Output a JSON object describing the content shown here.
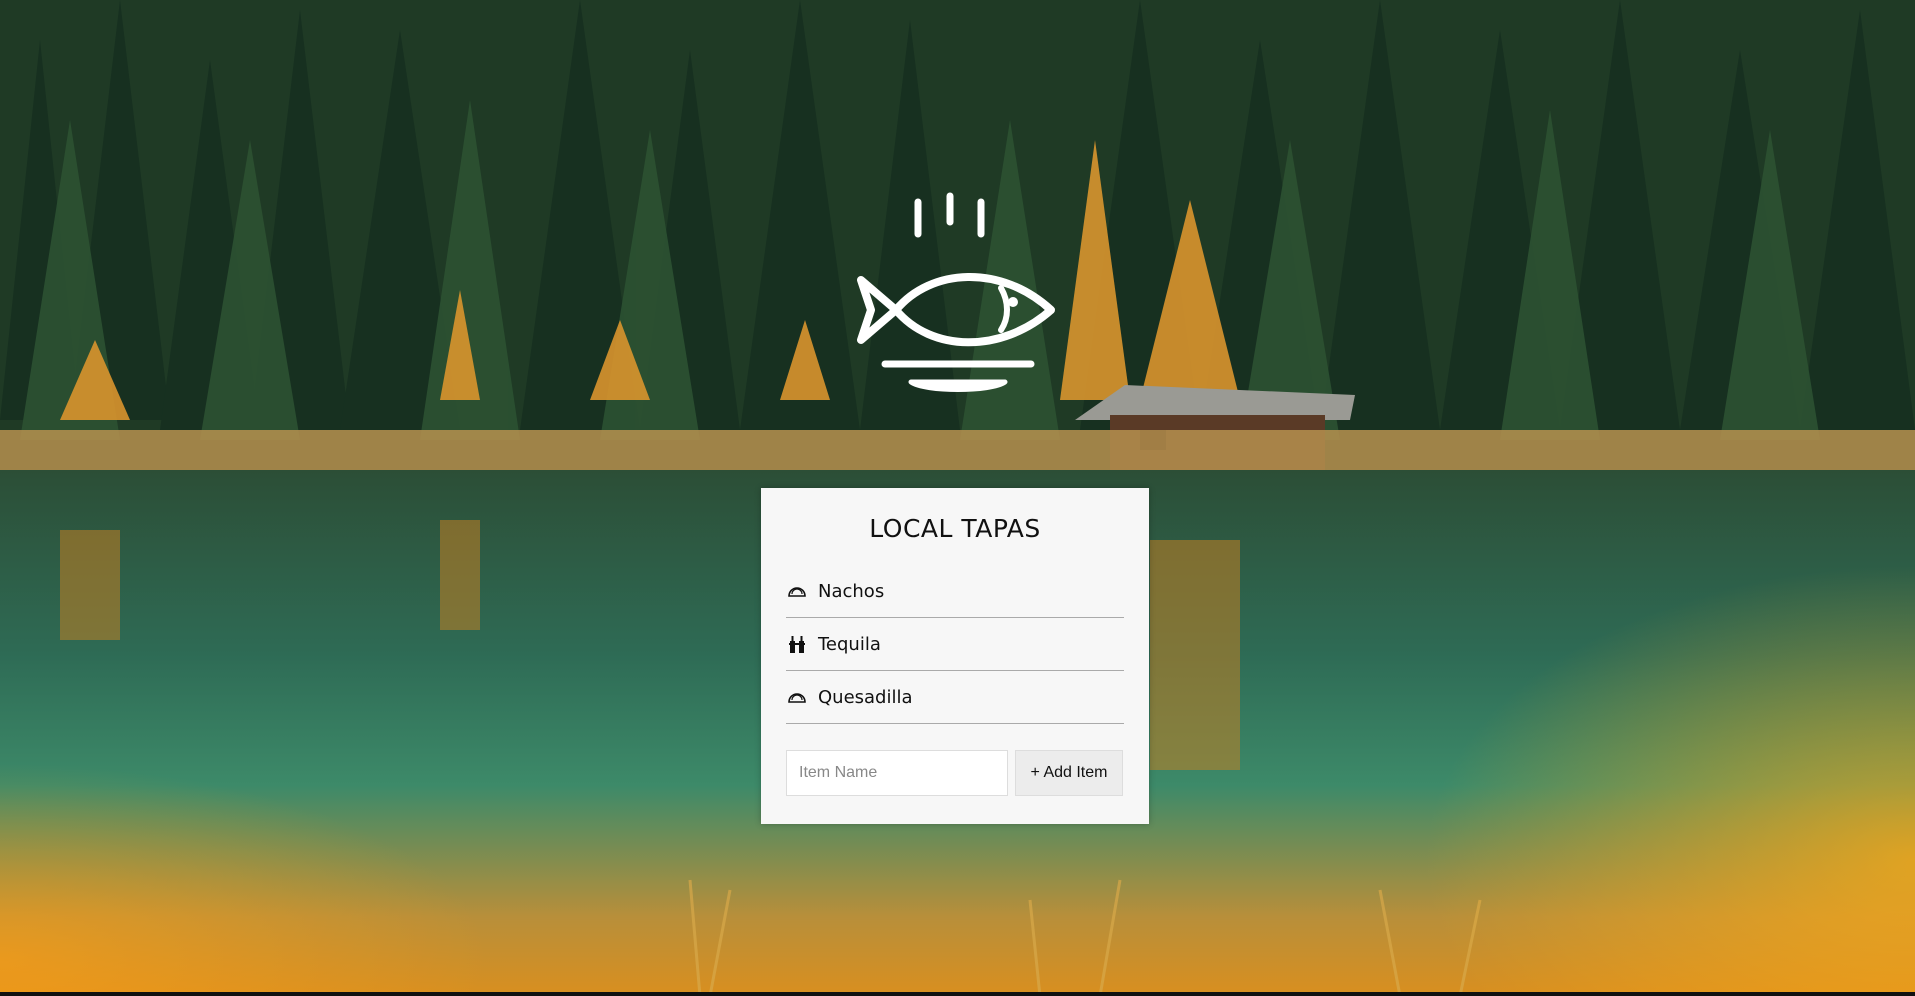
{
  "app": {
    "title": "LOCAL TAPAS",
    "logo_icon": "fish-dish-icon"
  },
  "menu": {
    "items": [
      {
        "label": "Nachos",
        "icon": "taco-icon"
      },
      {
        "label": "Tequila",
        "icon": "drinks-icon"
      },
      {
        "label": "Quesadilla",
        "icon": "taco-icon"
      }
    ]
  },
  "form": {
    "placeholder": "Item Name",
    "value": "",
    "add_label": "+ Add Item"
  },
  "colors": {
    "card_bg": "#f7f7f7",
    "text": "#111111",
    "divider": "#aaaaaa",
    "button_bg": "#ececec"
  }
}
